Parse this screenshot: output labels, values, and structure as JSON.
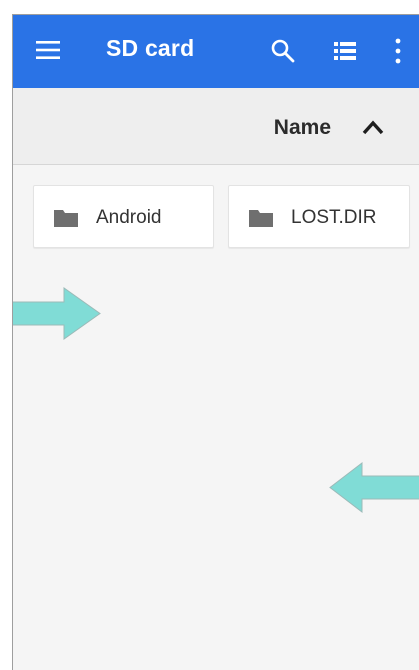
{
  "appbar": {
    "title": "SD card",
    "background": "#2a73e6",
    "icons": [
      "menu-icon",
      "search-icon",
      "list-view-icon",
      "more-vert-icon"
    ]
  },
  "sort": {
    "label": "Name",
    "direction": "ascending",
    "icon": "chevron-up-icon"
  },
  "folders": [
    {
      "name": "Android",
      "icon": "folder-icon"
    },
    {
      "name": "LOST.DIR",
      "icon": "folder-icon"
    }
  ],
  "overlay": {
    "arrow_color": "#80dcd6",
    "arrows": [
      "arrow-right",
      "arrow-left"
    ]
  }
}
